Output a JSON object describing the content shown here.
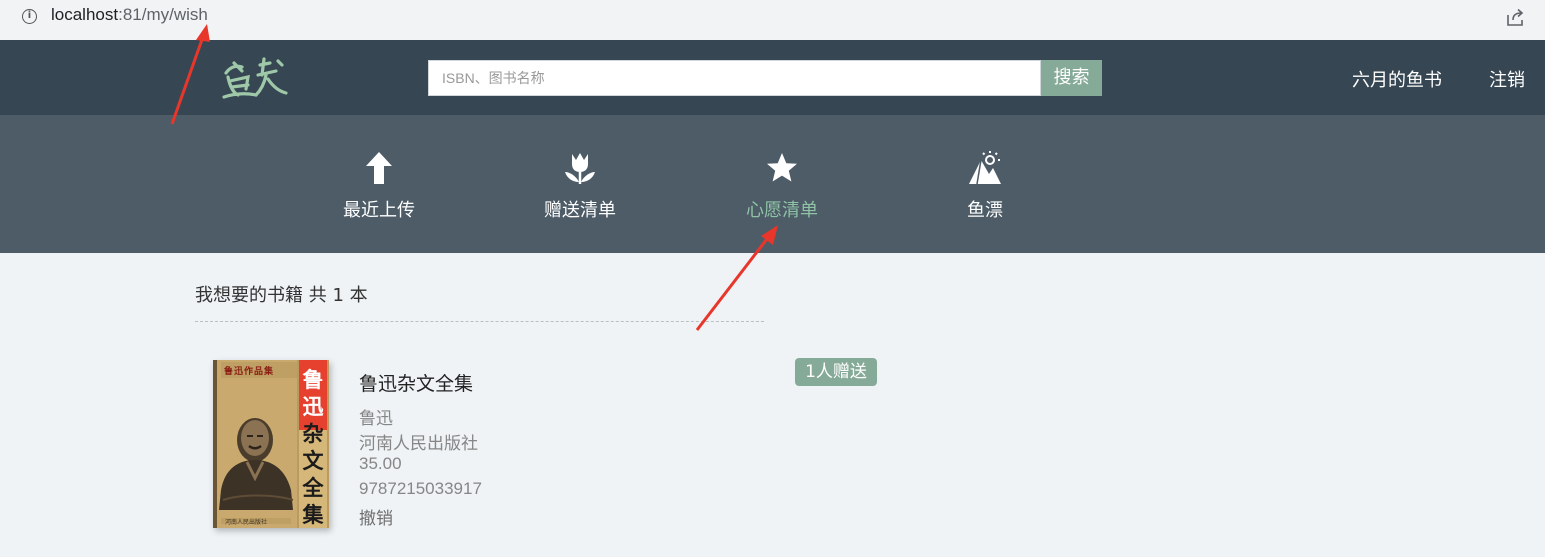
{
  "browser": {
    "url_host": "localhost",
    "url_path": ":81/my/wish",
    "info_icon": "i"
  },
  "header": {
    "logo_icon": "fish-book-logo-icon",
    "search": {
      "placeholder": "ISBN、图书名称",
      "button_label": "搜索"
    },
    "my_books": "六月的鱼书",
    "logout": "注销"
  },
  "nav": {
    "items": [
      {
        "label": "最近上传",
        "icon": "upload-arrow-icon",
        "active": false
      },
      {
        "label": "赠送清单",
        "icon": "tulip-icon",
        "active": false
      },
      {
        "label": "心愿清单",
        "icon": "star-icon",
        "active": true
      },
      {
        "label": "鱼漂",
        "icon": "mountain-sun-icon",
        "active": false
      }
    ],
    "active_color": "#8fc2a6"
  },
  "main": {
    "section_title": "我想要的书籍 共 1 本",
    "books": [
      {
        "title": "鲁迅杂文全集",
        "author": "鲁迅",
        "publisher": "河南人民出版社",
        "price": "35.00",
        "isbn": "9787215033917",
        "cancel_label": "撤销",
        "gift_badge": "1人赠送",
        "cover": {
          "series_text": "鲁迅作品集",
          "title_chars": [
            "鲁",
            "迅",
            "杂",
            "文",
            "全",
            "集"
          ],
          "publisher_text": "河南人民出版社"
        }
      }
    ]
  },
  "colors": {
    "header_bg": "#364652",
    "nav_bg": "#4d5c67",
    "accent_green": "#86aa98",
    "page_bg": "#eff3f6",
    "annotation_red": "#e8362b"
  }
}
